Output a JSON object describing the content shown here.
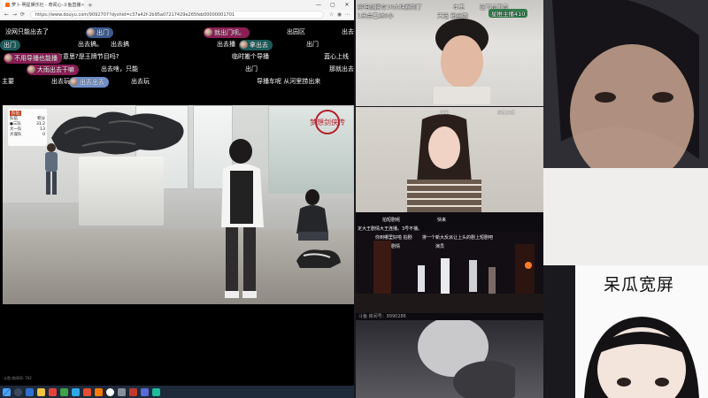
{
  "browser": {
    "tab_title": "萝卜·明星娱乐社 - 奇闻心-斗鱼直播",
    "tab_close": "×",
    "new_tab": "+",
    "url": "https://www.douyu.com/9092707?dyshid=c37a42f-2b95a07217429e265feb00000001701",
    "controls": {
      "minimize": "—",
      "maximize": "▢",
      "close": "✕"
    },
    "nav": {
      "back": "←",
      "forward": "→",
      "refresh": "⟳"
    }
  },
  "danmaku": [
    {
      "text": "没网只能出去了",
      "style": "plain"
    },
    {
      "text": "出门",
      "style": "blue"
    },
    {
      "text": "就出门呗。",
      "style": "pink"
    },
    {
      "text": "出园区",
      "style": "plain"
    },
    {
      "text": "出去了",
      "style": "plain"
    },
    {
      "text": "出门",
      "style": "teal"
    },
    {
      "text": "出去搞。",
      "style": "plain"
    },
    {
      "text": "出去搞",
      "style": "plain"
    },
    {
      "text": "出去播",
      "style": "plain"
    },
    {
      "text": "拿出去",
      "style": "teal"
    },
    {
      "text": "出门",
      "style": "plain"
    },
    {
      "text": "这步有意思?是王牌节目吗?",
      "style": "plain"
    },
    {
      "text": "临时搬个导播",
      "style": "plain"
    },
    {
      "text": "蓝心上线",
      "style": "plain"
    },
    {
      "text": "不用导播也能播",
      "style": "pink"
    },
    {
      "text": "大雨出去干嘛",
      "style": "pink"
    },
    {
      "text": "出去啥，只能",
      "style": "plain"
    },
    {
      "text": "出门",
      "style": "plain"
    },
    {
      "text": "那就出去",
      "style": "plain"
    },
    {
      "text": "主要",
      "style": "plain"
    },
    {
      "text": "出去出去",
      "style": "lightblue"
    },
    {
      "text": "出去玩",
      "style": "plain"
    },
    {
      "text": "导播车呢 从河里捞出来",
      "style": "plain"
    },
    {
      "text": "出去播",
      "style": "plain"
    }
  ],
  "scoreboard": {
    "header_team": "队伍",
    "header_score": "积分",
    "rows": [
      {
        "team": "●三队",
        "score": "31.2"
      },
      {
        "team": "大一队",
        "score": "13"
      },
      {
        "team": "大谋队",
        "score": "0"
      }
    ]
  },
  "video_logo": "梦想剑侠传",
  "video_footer": "斗鱼 房间ID: 702",
  "tile1_danmaku": [
    "给咱就搞有10大块搜到了",
    "1出会已过0小",
    "本王",
    "这不是不是",
    "天选 粉丝团",
    "星推主播410"
  ],
  "tile2_labels": [
    "没事",
    "星推主播"
  ],
  "tile3_danmaku": [
    "拍短剧呢",
    "快来",
    "定大王剧情大王连播。3号不播。",
    "你到哪里好啦 拍剧",
    "排一个新大反派让上头的剧上短剧吧",
    "剧情",
    "演员"
  ],
  "tile3_footer": "斗鱼 房间号：9990286",
  "webcam_title": "呆瓜宽屏",
  "taskbar_icons": [
    "windows-start",
    "search",
    "task-view",
    "edge",
    "explorer",
    "store",
    "mail",
    "wechat",
    "qq",
    "music",
    "douyu",
    "chrome",
    "settings",
    "app"
  ],
  "colors": {
    "danmaku_pink": "#8a1e55",
    "danmaku_teal": "#1d5a5a",
    "danmaku_blue": "#3b5a8f",
    "score_header": "#c44c2c"
  }
}
